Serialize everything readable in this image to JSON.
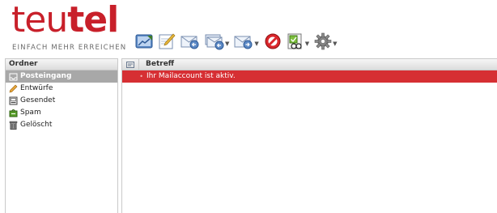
{
  "logo": {
    "part_a": "teu",
    "part_b": "tel",
    "tagline": "EINFACH MEHR ERREICHEN",
    "brand_color": "#c8202a"
  },
  "toolbar": {
    "buttons": [
      {
        "icon": "refresh-mail-icon",
        "has_dropdown": false
      },
      {
        "icon": "compose-icon",
        "has_dropdown": false
      },
      {
        "icon": "reply-icon",
        "has_dropdown": false
      },
      {
        "icon": "reply-all-icon",
        "has_dropdown": true
      },
      {
        "icon": "forward-icon",
        "has_dropdown": true
      },
      {
        "icon": "delete-icon",
        "has_dropdown": false
      },
      {
        "icon": "mark-icon",
        "has_dropdown": true
      },
      {
        "icon": "settings-gear-icon",
        "has_dropdown": true
      }
    ]
  },
  "folders": {
    "header": "Ordner",
    "items": [
      {
        "label": "Posteingang",
        "icon": "inbox-icon",
        "active": true
      },
      {
        "label": "Entwürfe",
        "icon": "pencil-icon",
        "active": false
      },
      {
        "label": "Gesendet",
        "icon": "sent-icon",
        "active": false
      },
      {
        "label": "Spam",
        "icon": "spam-icon",
        "active": false
      },
      {
        "label": "Gelöscht",
        "icon": "trash-icon",
        "active": false
      }
    ]
  },
  "messages": {
    "column_icon": "thread-icon",
    "column_subject": "Betreff",
    "rows": [
      {
        "bullet": "•",
        "subject": "Ihr Mailaccount ist aktiv.",
        "selected_color": "#d62f33"
      }
    ]
  }
}
